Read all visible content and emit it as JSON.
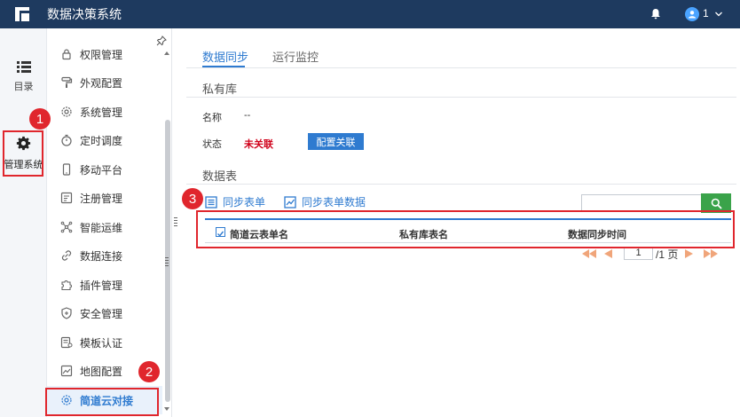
{
  "app": {
    "title": "数据决策系统",
    "user_name": "1"
  },
  "rail": {
    "items": [
      {
        "label": "目录",
        "icon": "list-icon"
      },
      {
        "label": "管理系统",
        "icon": "gear-icon"
      }
    ]
  },
  "menu": {
    "items": [
      {
        "label": "权限管理",
        "icon": "lock-icon"
      },
      {
        "label": "外观配置",
        "icon": "paint-roller-icon"
      },
      {
        "label": "系统管理",
        "icon": "gear-icon"
      },
      {
        "label": "定时调度",
        "icon": "timer-icon"
      },
      {
        "label": "移动平台",
        "icon": "mobile-icon"
      },
      {
        "label": "注册管理",
        "icon": "register-icon"
      },
      {
        "label": "智能运维",
        "icon": "network-icon"
      },
      {
        "label": "数据连接",
        "icon": "link-icon"
      },
      {
        "label": "插件管理",
        "icon": "puzzle-icon"
      },
      {
        "label": "安全管理",
        "icon": "shield-icon"
      },
      {
        "label": "模板认证",
        "icon": "certificate-icon"
      },
      {
        "label": "地图配置",
        "icon": "map-icon"
      },
      {
        "label": "简道云对接",
        "icon": "gear-icon"
      }
    ],
    "active_index": 12
  },
  "main": {
    "tabs": [
      {
        "label": "数据同步",
        "active": true
      },
      {
        "label": "运行监控",
        "active": false
      }
    ],
    "private_lib": {
      "title": "私有库",
      "name_label": "名称",
      "name_value": "--",
      "status_label": "状态",
      "status_value": "未关联",
      "config_button": "配置关联"
    },
    "data_table": {
      "title": "数据表",
      "sync_form": "同步表单",
      "sync_form_data": "同步表单数据",
      "search_placeholder": "",
      "columns": [
        "简道云表单名",
        "私有库表名",
        "数据同步时间"
      ],
      "page_current": "1",
      "page_total": "/1 页"
    }
  },
  "annotations": [
    "1",
    "2",
    "3"
  ],
  "colors": {
    "topbar": "#1e3a5f",
    "accent": "#2f7bd0",
    "annotation": "#e0262d",
    "search_button": "#3aa34a"
  }
}
